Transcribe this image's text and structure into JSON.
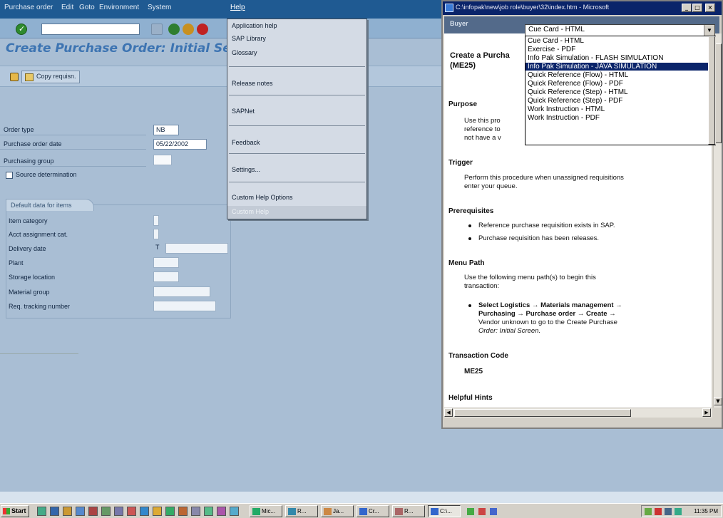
{
  "menubar": {
    "items": [
      "Purchase order",
      "Edit",
      "Goto",
      "Environment",
      "System",
      "Help"
    ]
  },
  "page": {
    "title": "Create Purchase Order: Initial Se"
  },
  "appbar": {
    "copy_button": "Copy requisn."
  },
  "form": {
    "order_type_label": "Order type",
    "order_type_value": "NB",
    "po_date_label": "Purchase order date",
    "po_date_value": "05/22/2002",
    "purch_group_label": "Purchasing group",
    "source_det_label": "Source determination"
  },
  "default_data": {
    "tab_label": "Default data for items",
    "rows": [
      {
        "label": "Item category",
        "value": ""
      },
      {
        "label": "Acct assignment cat.",
        "value": ""
      },
      {
        "label": "Delivery date",
        "value": "T"
      },
      {
        "label": "Plant",
        "value": ""
      },
      {
        "label": "Storage location",
        "value": ""
      },
      {
        "label": "Material group",
        "value": ""
      },
      {
        "label": "Req. tracking number",
        "value": ""
      }
    ]
  },
  "help_menu": {
    "items": [
      "Application help",
      "SAP Library",
      "Glossary",
      "Release notes",
      "SAPNet",
      "Feedback",
      "Settings...",
      "Custom Help Options"
    ],
    "disabled_item": "Custom Help"
  },
  "browser": {
    "title": "C:\\infopak\\new\\job role\\buyer\\32\\index.htm - Microsoft",
    "header_label": "Buyer",
    "selected_option": "Cue Card - HTML",
    "options": [
      "Cue Card - HTML",
      "Exercise - PDF",
      "Info Pak Simulation - FLASH SIMULATION",
      "Info Pak Simulation - JAVA SIMULATION",
      "Quick Reference (Flow) - HTML",
      "Quick Reference (Flow) - PDF",
      "Quick Reference (Step) - HTML",
      "Quick Reference (Step) - PDF",
      "Work Instruction - HTML",
      "Work Instruction - PDF"
    ],
    "highlighted_index": 3,
    "doc": {
      "heading_a": "Create a Purcha",
      "heading_b": "(ME25)",
      "purpose_h": "Purpose",
      "purpose_l1": "Use this pro",
      "purpose_l2": "reference to",
      "purpose_l3": "not have a v",
      "trigger_h": "Trigger",
      "trigger_l1": "Perform this procedure when unassigned requisitions",
      "trigger_l2": "enter your queue.",
      "prereq_h": "Prerequisites",
      "prereq_1": "Reference purchase requisition exists in SAP.",
      "prereq_2": "Purchase requisition has been releases.",
      "menupath_h": "Menu Path",
      "menupath_l1": "Use the following menu path(s) to begin this",
      "menupath_l2": "transaction:",
      "menupath_b1": "Select Logistics → Materials management →",
      "menupath_b2": "Purchasing → Purchase order → Create →",
      "menupath_b3": "Vendor unknown to go to the Create Purchase",
      "menupath_b4": "Order: Initial Screen.",
      "tcode_h": "Transaction Code",
      "tcode_v": "ME25",
      "hints_h": "Helpful Hints"
    }
  },
  "taskbar": {
    "start": "Start",
    "tasks": [
      "Mic...",
      "R...",
      "Ja...",
      "Cr...",
      "R...",
      "C:\\...",
      ""
    ],
    "clock": "11:35 PM"
  }
}
